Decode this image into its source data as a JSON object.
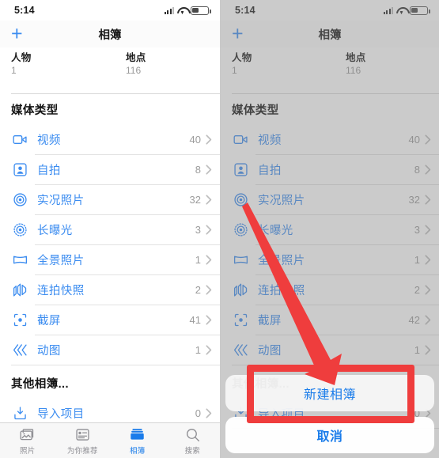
{
  "status_bar": {
    "time": "5:14",
    "icons": [
      "cellular-signal-icon",
      "wifi-icon",
      "battery-icon"
    ]
  },
  "nav_bar": {
    "add_label": "+",
    "title": "相簿"
  },
  "top_strip": [
    {
      "title": "人物",
      "count": "1"
    },
    {
      "title": "地点",
      "count": "116"
    }
  ],
  "media_section": {
    "heading": "媒体类型",
    "rows": [
      {
        "icon": "video-icon",
        "label": "视频",
        "count_left": "40",
        "count_right": "40"
      },
      {
        "icon": "selfie-icon",
        "label": "自拍",
        "count_left": "8",
        "count_right": "8"
      },
      {
        "icon": "live-photo-icon",
        "label": "实况照片",
        "count_left": "32",
        "count_right": "32"
      },
      {
        "icon": "long-exposure-icon",
        "label": "长曝光",
        "count_left": "3",
        "count_right": "3"
      },
      {
        "icon": "panorama-icon",
        "label": "全景照片",
        "count_left": "1",
        "count_right": "1"
      },
      {
        "icon": "burst-icon",
        "label": "连拍快照",
        "count_left": "2",
        "count_right": "2"
      },
      {
        "icon": "screenshot-icon",
        "label": "截屏",
        "count_left": "41",
        "count_right": "42"
      },
      {
        "icon": "animated-icon",
        "label": "动图",
        "count_left": "1",
        "count_right": "1"
      }
    ]
  },
  "other_section": {
    "heading": "其他相簿...",
    "rows": [
      {
        "icon": "import-icon",
        "label": "导入项目",
        "count": "0"
      }
    ]
  },
  "tab_bar": {
    "tabs": [
      {
        "icon": "photos-icon",
        "label": "照片",
        "active": false
      },
      {
        "icon": "for-you-icon",
        "label": "为你推荐",
        "active": false
      },
      {
        "icon": "albums-icon",
        "label": "相簿",
        "active": true
      },
      {
        "icon": "search-icon",
        "label": "搜索",
        "active": false
      }
    ]
  },
  "action_sheet": {
    "new_album_label": "新建相簿",
    "cancel_label": "取消"
  },
  "annotations": {
    "arrow": "red-arrow-pointing-to-new-album",
    "highlight_box": "red-rectangle-around-new-album"
  },
  "colors": {
    "accent_blue": "#3b8cf0",
    "tab_active_blue": "#1a7cea",
    "annotation_red": "#ef3d3d",
    "secondary_gray": "#9c9c9c"
  }
}
